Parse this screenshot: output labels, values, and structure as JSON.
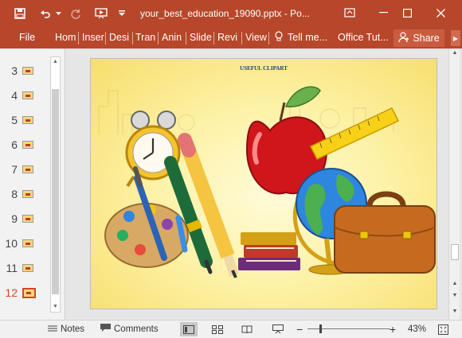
{
  "title_bar": {
    "doc_title": "your_best_education_19090.pptx - Po...",
    "icons": [
      "save-icon",
      "undo-icon",
      "redo-icon",
      "present-from-start-icon",
      "customize-toolbar-icon",
      "ribbon-options-icon",
      "minimize-icon",
      "maximize-icon",
      "close-icon"
    ]
  },
  "ribbon": {
    "tabs": [
      "File",
      "Hom",
      "Inser",
      "Desi",
      "Tran",
      "Anin",
      "Slide",
      "Revi",
      "View"
    ],
    "tell_me": "Tell me...",
    "office_tutor": "Office Tut...",
    "share": "Share",
    "accent": "#b7472a"
  },
  "thumbnails": {
    "numbers": [
      "3",
      "4",
      "5",
      "6",
      "7",
      "8",
      "9",
      "10",
      "11",
      "12"
    ],
    "active": "12",
    "active_color": "#d24726"
  },
  "slide": {
    "title": "USEFUL CLIPART",
    "background_colors": [
      "#fffbd8",
      "#f7de6b"
    ]
  },
  "status_bar": {
    "notes": "Notes",
    "comments": "Comments",
    "zoom_percent": "43%",
    "zoom_level": 0.43
  }
}
